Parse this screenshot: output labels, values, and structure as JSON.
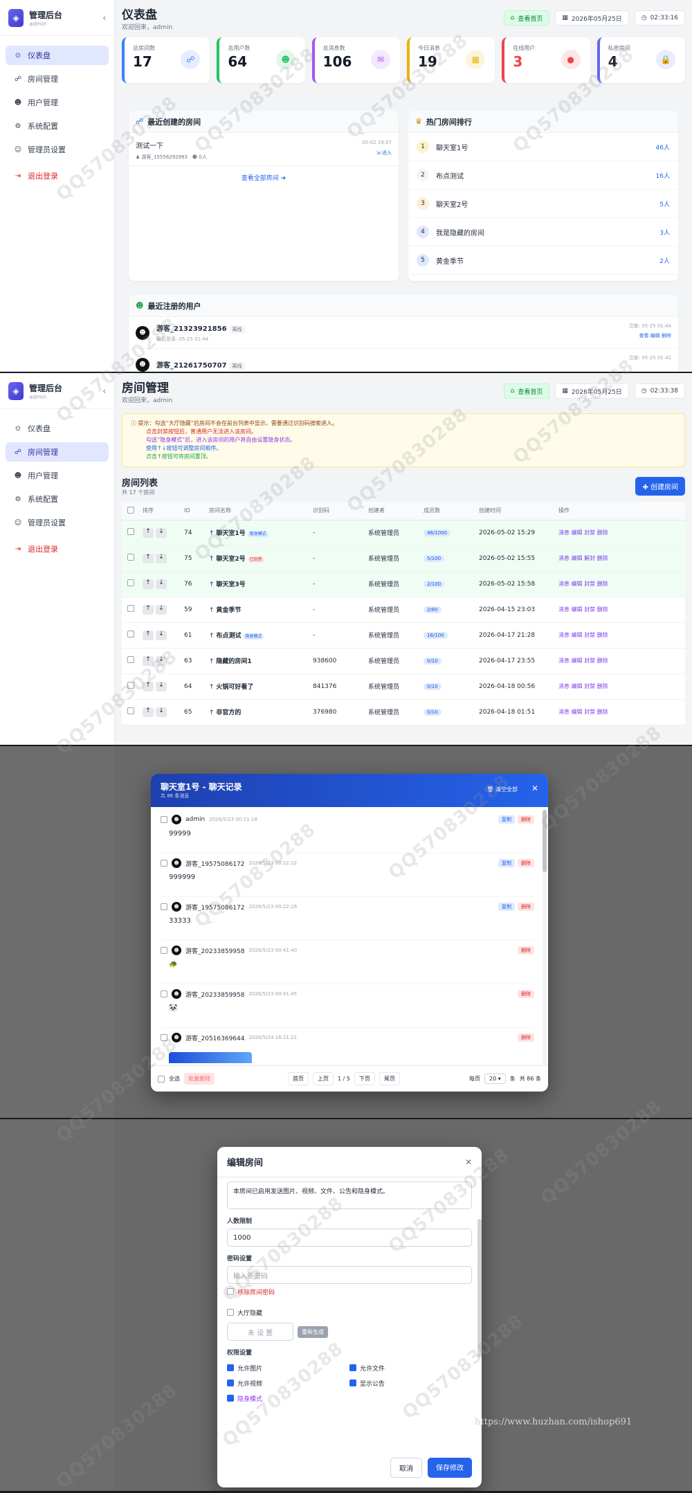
{
  "watermark": "QQ570830288",
  "footer_url": "https://www.huzhan.com/ishop691",
  "sidebar": {
    "title": "管理后台",
    "subtitle": "admin",
    "collapse": "‹",
    "items": [
      {
        "icon": "⊙",
        "label": "仪表盘"
      },
      {
        "icon": "☍",
        "label": "房间管理"
      },
      {
        "icon": "☻",
        "label": "用户管理"
      },
      {
        "icon": "⚙",
        "label": "系统配置"
      },
      {
        "icon": "☺",
        "label": "管理员设置"
      }
    ],
    "logout": "退出登录"
  },
  "header": {
    "home": "查看首页",
    "date": "2026年05月25日"
  },
  "dashboard": {
    "title": "仪表盘",
    "welcome": "欢迎回来，admin",
    "time": "02:33:16",
    "stats": [
      {
        "label": "总房间数",
        "value": "17",
        "color": "#3b82f6",
        "icon": "☍"
      },
      {
        "label": "总用户数",
        "value": "64",
        "color": "#22c55e",
        "icon": "☻"
      },
      {
        "label": "总消息数",
        "value": "106",
        "color": "#a855f7",
        "icon": "✉"
      },
      {
        "label": "今日消息",
        "value": "19",
        "color": "#eab308",
        "icon": "▦"
      },
      {
        "label": "在线用户",
        "value": "3",
        "color": "#ef4444",
        "icon": "●"
      },
      {
        "label": "私密房间",
        "value": "4",
        "color": "#6366f1",
        "icon": "🔒"
      }
    ],
    "recent_rooms_title": "最近创建的房间",
    "recent_room": {
      "name": "测试一下",
      "creator": "游客_15556292983",
      "members": "0人",
      "date": "05-02 19:07",
      "enter": "进入"
    },
    "view_all": "查看全部房间 ➜",
    "hot_title": "热门房间排行",
    "hot": [
      {
        "rank": "1",
        "name": "聊天室1号",
        "count": "46人"
      },
      {
        "rank": "2",
        "name": "布点测试",
        "count": "16人"
      },
      {
        "rank": "3",
        "name": "聊天室2号",
        "count": "5人"
      },
      {
        "rank": "4",
        "name": "我是隐藏的房间",
        "count": "3人"
      },
      {
        "rank": "5",
        "name": "黄金季节",
        "count": "2人"
      }
    ],
    "new_users_title": "最近注册的用户",
    "users": [
      {
        "name": "游客_21323921856",
        "status": "离线",
        "last": "最后登录: 05-25 01:44",
        "reg": "注册: 05-25 01:44",
        "ops": "查看 编辑 删除"
      },
      {
        "name": "游客_21261750707",
        "status": "离线",
        "last": "",
        "reg": "注册: 05-25 01:42",
        "ops": ""
      }
    ]
  },
  "rooms": {
    "title": "房间管理",
    "welcome": "欢迎回来，admin",
    "time": "02:33:38",
    "notice": [
      "提示：勾选“大厅隐藏”后房间不会在前台列表中显示，需要通过识别码搜索进入。",
      "点击封禁按钮后，普通用户无法进入该房间。",
      "勾选“隐身模式”后，进入该房间的用户将自由设置隐身状态。",
      "使用↑↓按钮可调整房间顺序。",
      "点击↑按钮可将房间置顶。"
    ],
    "list_title": "房间列表",
    "list_count": "共 17 个房间",
    "create": "✚ 创建房间",
    "columns": [
      "",
      "排序",
      "ID",
      "房间名称",
      "识别码",
      "创建者",
      "成员数",
      "创建时间",
      "操作"
    ],
    "rows": [
      {
        "id": "74",
        "name": "聊天室1号",
        "tag": "隐身模式",
        "code": "-",
        "creator": "系统管理员",
        "members": "46/1000",
        "time": "2026-05-02 15:29",
        "ops": "消息 编辑 封禁 删除",
        "hl": true
      },
      {
        "id": "75",
        "name": "聊天室2号",
        "tag": "已封禁",
        "code": "-",
        "creator": "系统管理员",
        "members": "5/100",
        "time": "2026-05-02 15:55",
        "ops": "消息 编辑 解封 删除",
        "hl": true
      },
      {
        "id": "76",
        "name": "聊天室3号",
        "tag": "",
        "code": "-",
        "creator": "系统管理员",
        "members": "2/100",
        "time": "2026-05-02 15:58",
        "ops": "消息 编辑 封禁 删除",
        "hl": true
      },
      {
        "id": "59",
        "name": "黄金季节",
        "tag": "",
        "code": "-",
        "creator": "系统管理员",
        "members": "2/80",
        "time": "2026-04-15 23:03",
        "ops": "消息 编辑 封禁 删除",
        "hl": false
      },
      {
        "id": "61",
        "name": "布点测试",
        "tag": "隐身模式",
        "code": "-",
        "creator": "系统管理员",
        "members": "16/100",
        "time": "2026-04-17 21:28",
        "ops": "消息 编辑 封禁 删除",
        "hl": false
      },
      {
        "id": "63",
        "name": "隐藏的房间1",
        "tag": "",
        "code": "938600",
        "creator": "系统管理员",
        "members": "0/10",
        "time": "2026-04-17 23:55",
        "ops": "消息 编辑 封禁 删除",
        "hl": false
      },
      {
        "id": "64",
        "name": "火锅可好看了",
        "tag": "",
        "code": "841376",
        "creator": "系统管理员",
        "members": "0/10",
        "time": "2026-04-18 00:56",
        "ops": "消息 编辑 封禁 删除",
        "hl": false
      },
      {
        "id": "65",
        "name": "非官方的",
        "tag": "",
        "code": "376980",
        "creator": "系统管理员",
        "members": "0/10",
        "time": "2026-04-18 01:51",
        "ops": "消息 编辑 封禁 删除",
        "hl": false
      }
    ]
  },
  "chat_modal": {
    "title": "聊天室1号 - 聊天记录",
    "count": "共 86 条消息",
    "clear": "🗑 清空全部",
    "close": "✕",
    "copy": "复制",
    "delete": "删除",
    "messages": [
      {
        "user": "admin",
        "time": "2026/5/23 00:21:18",
        "text": "99999",
        "copy": true
      },
      {
        "user": "游客_19575086172",
        "time": "2026/5/23 00:22:22",
        "text": "999999",
        "copy": true
      },
      {
        "user": "游客_19575086172",
        "time": "2026/5/23 00:22:26",
        "text": "33333",
        "copy": true
      },
      {
        "user": "游客_20233859958",
        "time": "2026/5/23 00:41:40",
        "text": "🐢",
        "copy": false
      },
      {
        "user": "游客_20233859958",
        "time": "2026/5/23 00:41:45",
        "text": "🐼",
        "copy": false
      },
      {
        "user": "游客_20516369644",
        "time": "2026/5/24 16:21:21",
        "text": "",
        "copy": false
      }
    ],
    "select_all": "全选",
    "batch_delete": "批量删除",
    "first": "首页",
    "prev": "上页",
    "page": "1 / 5",
    "next": "下页",
    "last": "尾页",
    "per_page_label": "每页",
    "per_page": "20",
    "unit": "条",
    "total": "共 86 条"
  },
  "edit_modal": {
    "title": "编辑房间",
    "close": "✕",
    "desc": "本房间已启用发送图片、视频、文件、公告和隐身模式。",
    "limit_label": "人数限制",
    "limit": "1000",
    "pwd_label": "密码设置",
    "pwd_placeholder": "输入新密码",
    "remove_pwd": "移除房间密码",
    "hidden": "大厅隐藏",
    "code_placeholder": "未 设 置",
    "regen": "重新生成",
    "perm_label": "权限设置",
    "perms": [
      {
        "label": "允许图片",
        "on": true
      },
      {
        "label": "允许文件",
        "on": true
      },
      {
        "label": "允许视频",
        "on": true
      },
      {
        "label": "显示公告",
        "on": true
      },
      {
        "label": "隐身模式",
        "on": true
      }
    ],
    "cancel": "取消",
    "save": "保存修改"
  }
}
